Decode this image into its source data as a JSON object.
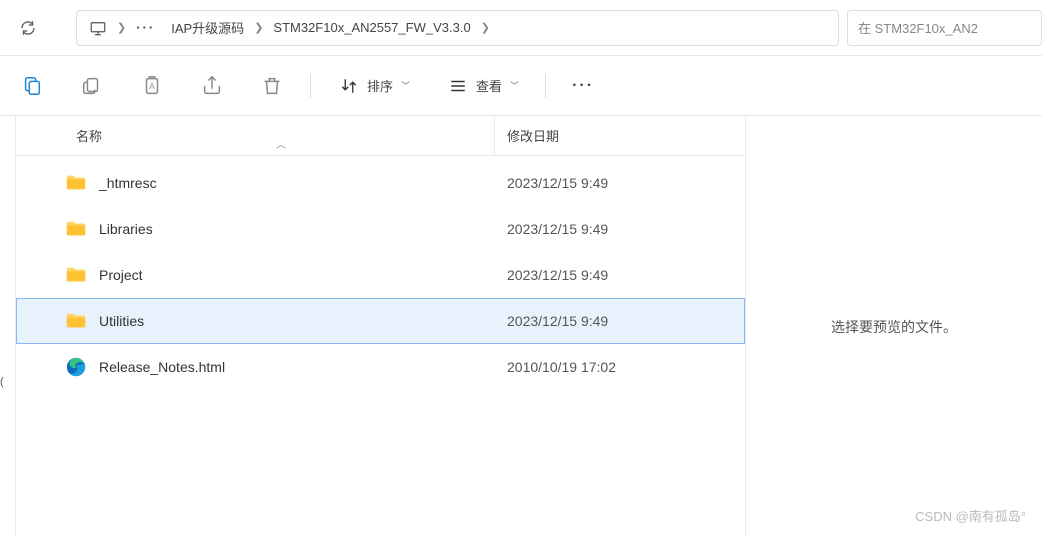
{
  "breadcrumb": {
    "items": [
      "IAP升级源码",
      "STM32F10x_AN2557_FW_V3.3.0"
    ]
  },
  "search": {
    "placeholder": "在 STM32F10x_AN2"
  },
  "toolbar": {
    "sort": "排序",
    "view": "查看"
  },
  "columns": {
    "name": "名称",
    "modified": "修改日期"
  },
  "files": [
    {
      "name": "_htmresc",
      "date": "2023/12/15 9:49",
      "type": "folder"
    },
    {
      "name": "Libraries",
      "date": "2023/12/15 9:49",
      "type": "folder"
    },
    {
      "name": "Project",
      "date": "2023/12/15 9:49",
      "type": "folder"
    },
    {
      "name": "Utilities",
      "date": "2023/12/15 9:49",
      "type": "folder",
      "selected": true
    },
    {
      "name": "Release_Notes.html",
      "date": "2010/10/19 17:02",
      "type": "html"
    }
  ],
  "preview": {
    "empty": "选择要预览的文件。"
  },
  "watermark": "CSDN @南有孤岛°",
  "leftchar": "("
}
